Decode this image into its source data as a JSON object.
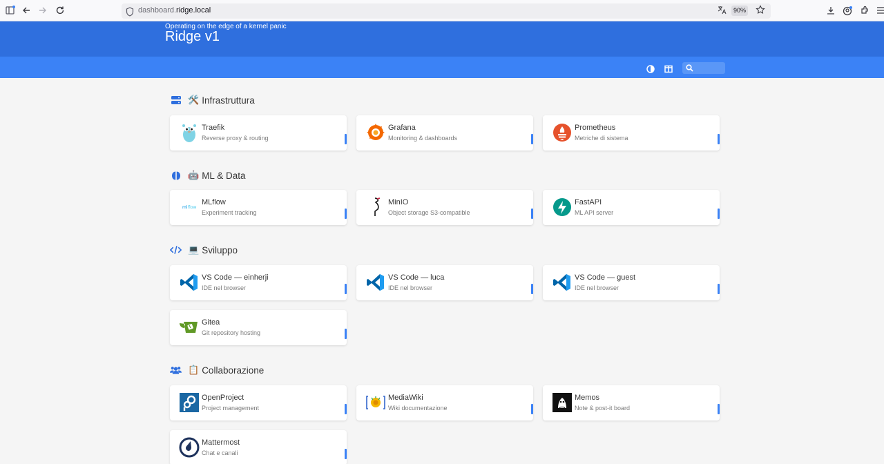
{
  "browser": {
    "url_prefix": "dashboard.",
    "url_domain": "ridge.local",
    "zoom": "90%"
  },
  "header": {
    "subtitle": "Operating on the edge of a kernel panic",
    "title": "Ridge v1"
  },
  "groups": [
    {
      "name": "Infrastruttura",
      "emoji": "🛠️",
      "items": [
        {
          "name": "Traefik",
          "desc": "Reverse proxy & routing"
        },
        {
          "name": "Grafana",
          "desc": "Monitoring & dashboards"
        },
        {
          "name": "Prometheus",
          "desc": "Metriche di sistema"
        }
      ]
    },
    {
      "name": "ML & Data",
      "emoji": "🤖",
      "items": [
        {
          "name": "MLflow",
          "desc": "Experiment tracking"
        },
        {
          "name": "MinIO",
          "desc": "Object storage S3-compatible"
        },
        {
          "name": "FastAPI",
          "desc": "ML API server"
        }
      ]
    },
    {
      "name": "Sviluppo",
      "emoji": "💻",
      "items": [
        {
          "name": "VS Code — einherji",
          "desc": "IDE nel browser"
        },
        {
          "name": "VS Code — luca",
          "desc": "IDE nel browser"
        },
        {
          "name": "VS Code — guest",
          "desc": "IDE nel browser"
        },
        {
          "name": "Gitea",
          "desc": "Git repository hosting"
        }
      ]
    },
    {
      "name": "Collaborazione",
      "emoji": "📋",
      "items": [
        {
          "name": "OpenProject",
          "desc": "Project management"
        },
        {
          "name": "MediaWiki",
          "desc": "Wiki documentazione"
        },
        {
          "name": "Memos",
          "desc": "Note & post-it board"
        },
        {
          "name": "Mattermost",
          "desc": "Chat e canali"
        }
      ]
    }
  ],
  "colors": {
    "header": "#2f6fde",
    "navbar": "#3b82f6",
    "accent": "#3b82f6",
    "background": "#f5f5f5"
  }
}
